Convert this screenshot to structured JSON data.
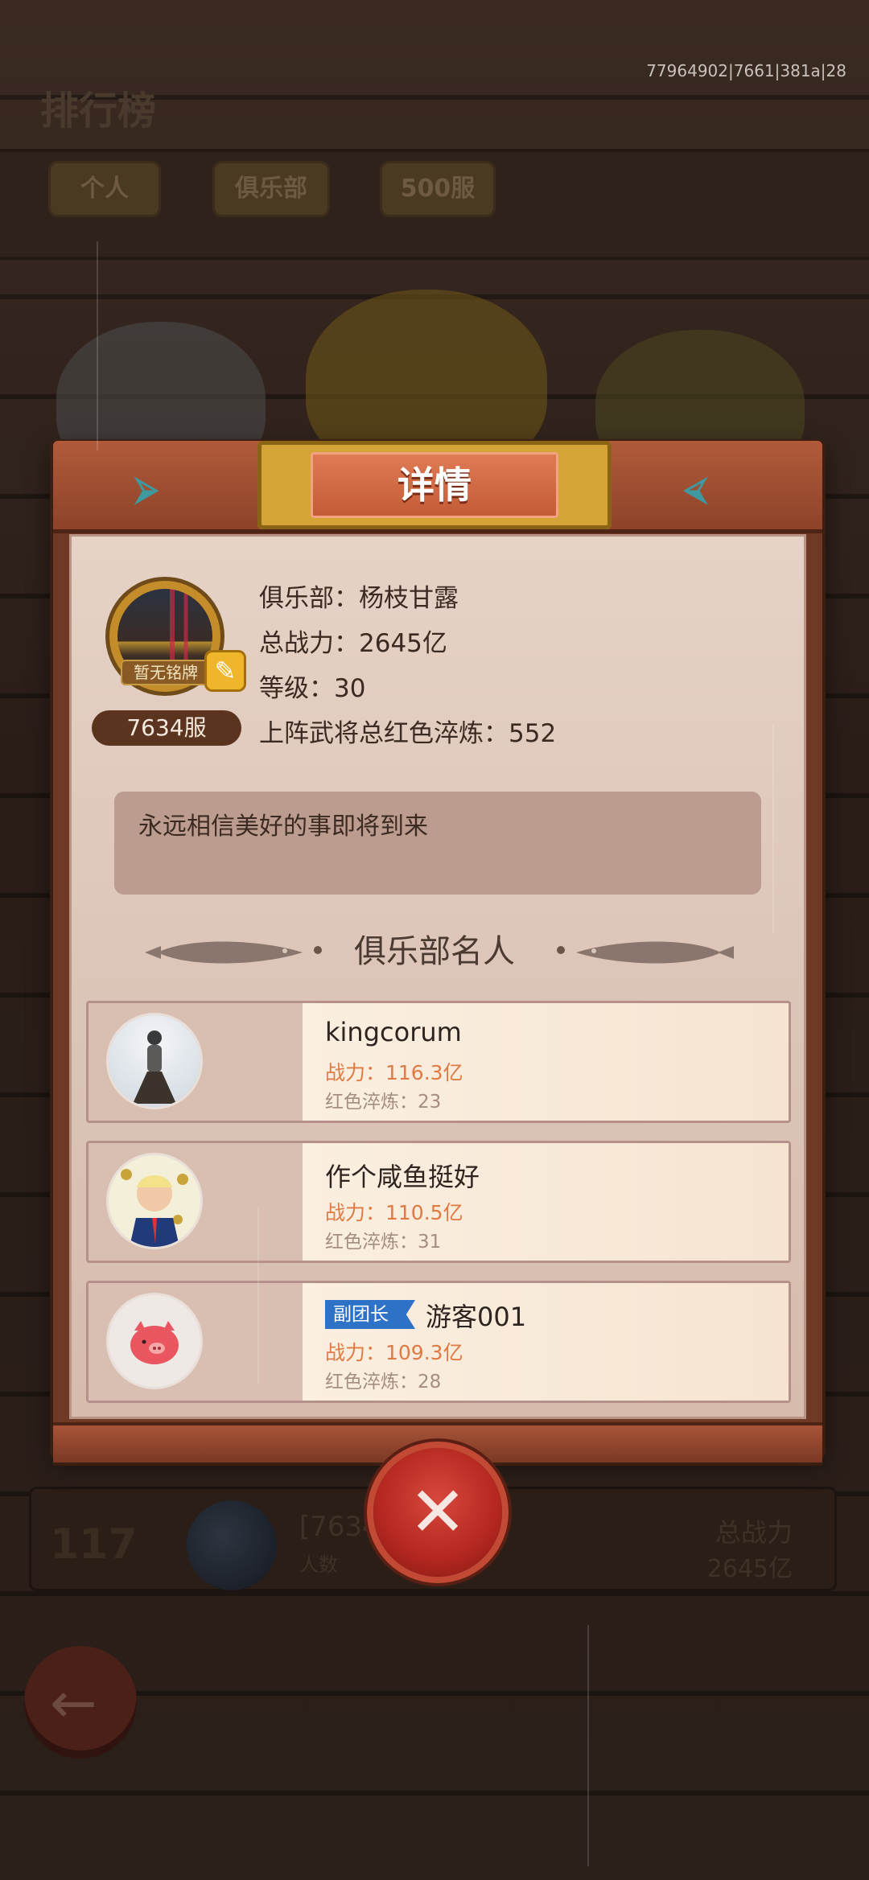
{
  "background": {
    "title": "排行榜",
    "debug_id": "77964902|7661|381a|28",
    "tabs": [
      "个人",
      "俱乐部",
      "500服"
    ],
    "row": {
      "rank": "117",
      "name": "[7634",
      "sub": "人数",
      "power_label": "总战力",
      "power_value": "2645亿"
    }
  },
  "modal": {
    "title": "详情",
    "profile": {
      "nameplate": "暂无铭牌",
      "server": "7634服",
      "club": "俱乐部：杨枝甘露",
      "total_power": "总战力：2645亿",
      "level": "等级：30",
      "red_temper": "上阵武将总红色淬炼：552"
    },
    "signature": "永远相信美好的事即将到来",
    "famous_title": "俱乐部名人",
    "members": [
      {
        "name": "kingcorum",
        "power": "战力：116.3亿",
        "red": "红色淬炼：23",
        "role": ""
      },
      {
        "name": "作个咸鱼挺好",
        "power": "战力：110.5亿",
        "red": "红色淬炼：31",
        "role": ""
      },
      {
        "name": "游客001",
        "power": "战力：109.3亿",
        "red": "红色淬炼：28",
        "role": "副团长"
      }
    ]
  },
  "colors": {
    "accent_gold": "#d4a436",
    "header_red": "#c25a36",
    "power_orange": "#e07a43",
    "vice_badge_blue": "#2e72c8",
    "close_red": "#b3271f"
  },
  "icons": [
    "edit-icon",
    "close-icon",
    "back-arrow-icon",
    "fish-icon"
  ]
}
